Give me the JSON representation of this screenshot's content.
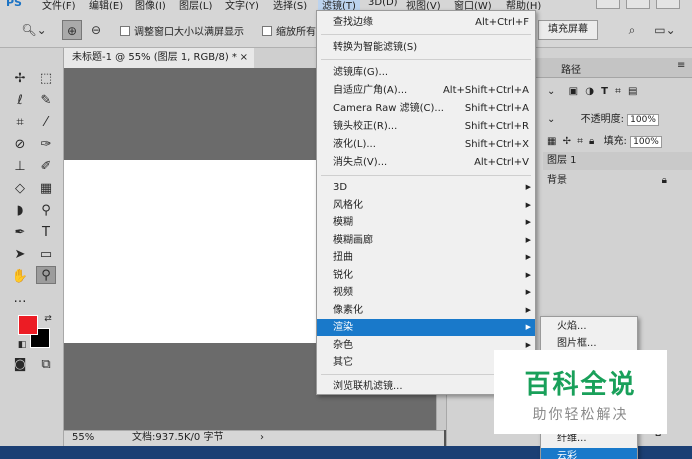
{
  "app": {
    "logo": "PS"
  },
  "menubar": {
    "items": [
      "文件(F)",
      "编辑(E)",
      "图像(I)",
      "图层(L)",
      "文字(Y)",
      "选择(S)",
      "滤镜(T)",
      "3D(D)",
      "视图(V)",
      "窗口(W)",
      "帮助(H)"
    ]
  },
  "options": {
    "resize_label": "调整窗口大小以满屏显示",
    "zoom_all_label": "缩放所有",
    "fill_screen": "填充屏幕"
  },
  "document": {
    "tab_title": "未标题-1 @ 55% (图层 1, RGB/8) *",
    "close": "×"
  },
  "status": {
    "zoom": "55%",
    "doc_size": "文档:937.5K/0 字节"
  },
  "layers_panel": {
    "tab_path": "路径",
    "opacity_label": "不透明度:",
    "opacity_value": "100%",
    "fill_label": "填充:",
    "fill_value": "100%",
    "layers": [
      {
        "name": "图层 1"
      },
      {
        "name": "背景"
      }
    ]
  },
  "filter_menu": {
    "items": [
      {
        "label": "查找边缘",
        "shortcut": "Alt+Ctrl+F"
      },
      {
        "label": "转换为智能滤镜(S)",
        "shortcut": ""
      },
      {
        "label": "滤镜库(G)...",
        "shortcut": ""
      },
      {
        "label": "自适应广角(A)...",
        "shortcut": "Alt+Shift+Ctrl+A"
      },
      {
        "label": "Camera Raw 滤镜(C)...",
        "shortcut": "Shift+Ctrl+A"
      },
      {
        "label": "镜头校正(R)...",
        "shortcut": "Shift+Ctrl+R"
      },
      {
        "label": "液化(L)...",
        "shortcut": "Shift+Ctrl+X"
      },
      {
        "label": "消失点(V)...",
        "shortcut": "Alt+Ctrl+V"
      },
      {
        "label": "3D",
        "shortcut": ""
      },
      {
        "label": "风格化",
        "shortcut": ""
      },
      {
        "label": "模糊",
        "shortcut": ""
      },
      {
        "label": "模糊画廊",
        "shortcut": ""
      },
      {
        "label": "扭曲",
        "shortcut": ""
      },
      {
        "label": "锐化",
        "shortcut": ""
      },
      {
        "label": "视频",
        "shortcut": ""
      },
      {
        "label": "像素化",
        "shortcut": ""
      },
      {
        "label": "渲染",
        "shortcut": ""
      },
      {
        "label": "杂色",
        "shortcut": ""
      },
      {
        "label": "其它",
        "shortcut": ""
      },
      {
        "label": "浏览联机滤镜...",
        "shortcut": ""
      }
    ]
  },
  "render_submenu": {
    "items": [
      "火焰...",
      "图片框...",
      "纤维...",
      "云彩"
    ]
  },
  "watermark": {
    "title": "百科全说",
    "subtitle": "助你轻松解决"
  },
  "colors": {
    "foreground": "#ec1c24",
    "background": "#000000",
    "menu_highlight": "#1979ca"
  }
}
